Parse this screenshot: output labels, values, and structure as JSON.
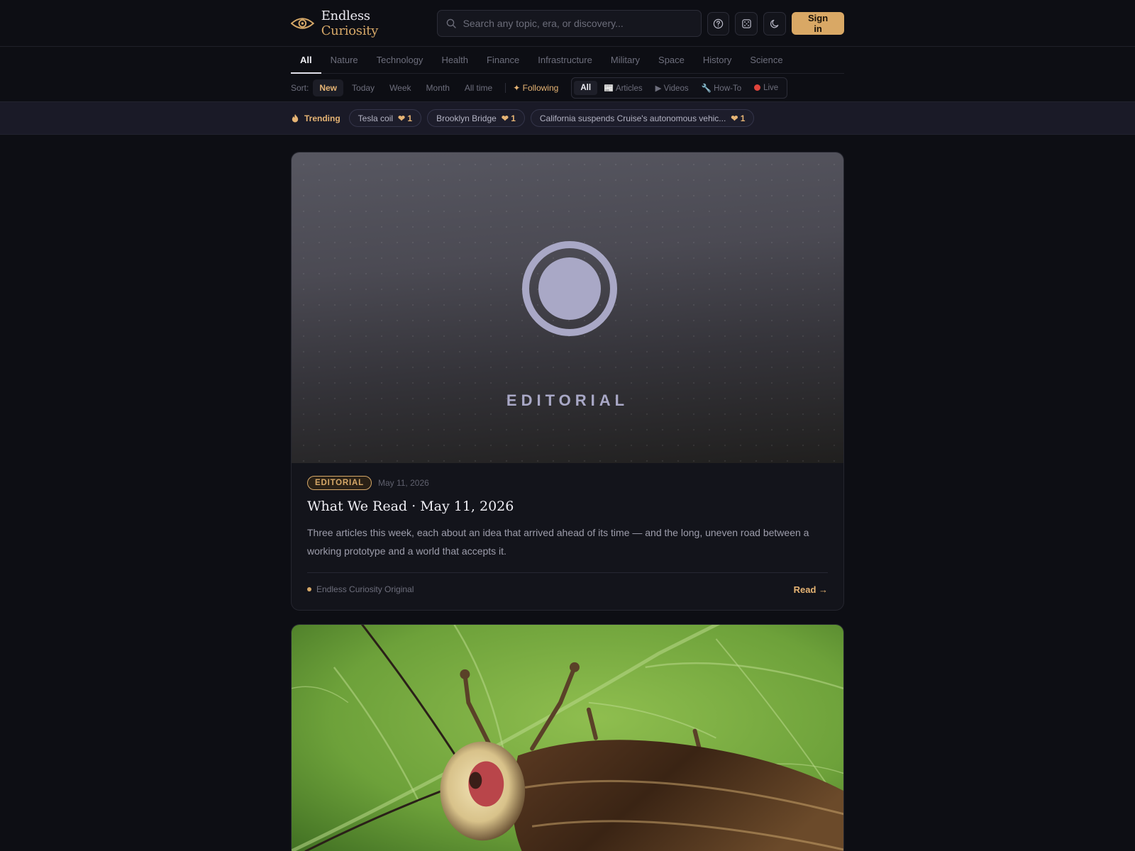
{
  "brand": {
    "name_part1": "Endless",
    "name_part2": "Curiosity"
  },
  "search": {
    "placeholder": "Search any topic, era, or discovery..."
  },
  "header": {
    "signin_label": "Sign in"
  },
  "categories": [
    "All",
    "Nature",
    "Technology",
    "Health",
    "Finance",
    "Infrastructure",
    "Military",
    "Space",
    "History",
    "Science"
  ],
  "sort": {
    "label": "Sort:",
    "options": [
      "New",
      "Today",
      "Week",
      "Month",
      "All time"
    ],
    "following": "✦ Following"
  },
  "content_types": [
    "All",
    "📰 Articles",
    "▶ Videos",
    "🔧 How-To",
    "Live"
  ],
  "trending": {
    "label": "Trending",
    "items": [
      {
        "title": "Tesla coil",
        "likes": "❤ 1"
      },
      {
        "title": "Brooklyn Bridge",
        "likes": "❤ 1"
      },
      {
        "title": "California suspends Cruise's autonomous vehic...",
        "likes": "❤ 1"
      }
    ]
  },
  "featured": {
    "hero_word": "EDITORIAL",
    "tag": "EDITORIAL",
    "date": "May 11, 2026",
    "title": "What We Read · May 11, 2026",
    "excerpt": "Three articles this week, each about an idea that arrived ahead of its time — and the long, uneven road between a working prototype and a world that accepts it.",
    "source": "Endless Curiosity Original",
    "read_label": "Read →"
  },
  "colors": {
    "accent": "#d9a865",
    "background": "#0d0e14",
    "live": "#e0443c"
  }
}
